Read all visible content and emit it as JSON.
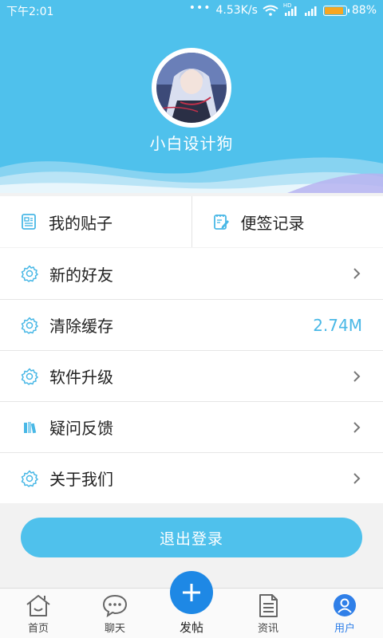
{
  "status_bar": {
    "time": "下午2:01",
    "network_speed": "4.53K/s",
    "hd_badge": "HD",
    "battery": "88%"
  },
  "profile": {
    "username": "小白设计狗"
  },
  "shortcuts": [
    {
      "label": "我的贴子",
      "icon": "document-list-icon"
    },
    {
      "label": "便签记录",
      "icon": "note-edit-icon"
    }
  ],
  "menu": [
    {
      "label": "新的好友",
      "icon": "gear-icon",
      "value": ""
    },
    {
      "label": "清除缓存",
      "icon": "gear-icon",
      "value": "2.74M"
    },
    {
      "label": "软件升级",
      "icon": "gear-icon",
      "value": ""
    },
    {
      "label": "疑问反馈",
      "icon": "books-icon",
      "value": ""
    },
    {
      "label": "关于我们",
      "icon": "gear-icon",
      "value": ""
    }
  ],
  "logout_label": "退出登录",
  "tabs": [
    {
      "label": "首页",
      "icon": "home-icon"
    },
    {
      "label": "聊天",
      "icon": "chat-icon"
    },
    {
      "label": "发帖",
      "icon": "plus-icon"
    },
    {
      "label": "资讯",
      "icon": "news-icon"
    },
    {
      "label": "用户",
      "icon": "user-icon"
    }
  ],
  "colors": {
    "accent": "#4fc1ec",
    "value_text": "#49b8e6",
    "active_tab": "#2f7fe8",
    "fab": "#1e88e5"
  }
}
